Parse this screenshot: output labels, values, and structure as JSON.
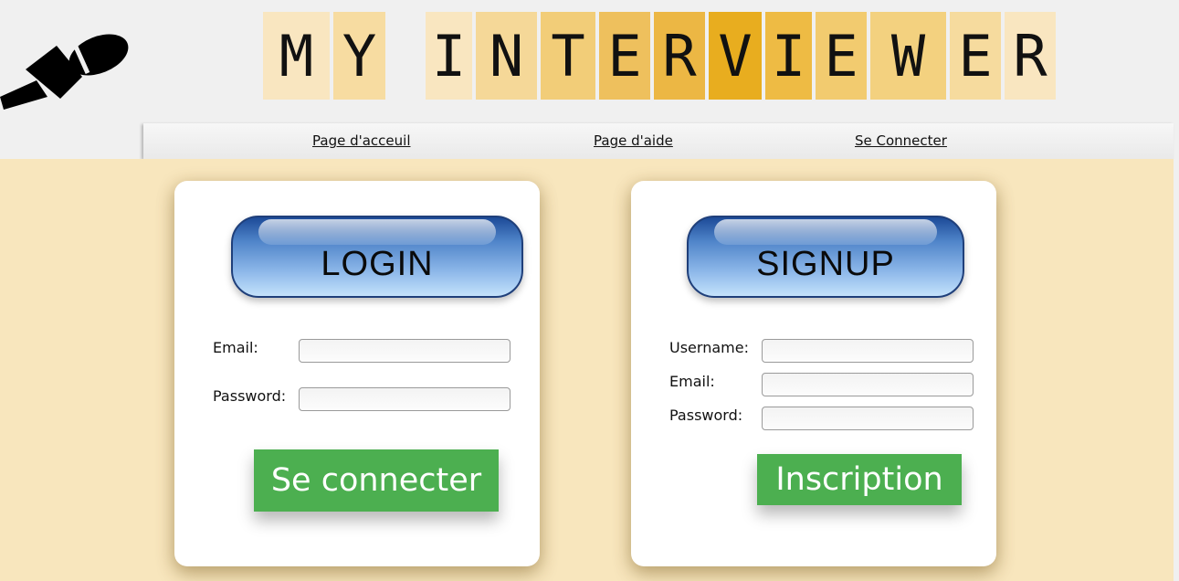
{
  "header": {
    "title_letters": [
      {
        "ch": "M",
        "color": "#f9e6c0"
      },
      {
        "ch": "Y",
        "color": "#f7dca1"
      },
      {
        "ch": "I",
        "color": "#f9e6c0"
      },
      {
        "ch": "N",
        "color": "#f5d898"
      },
      {
        "ch": "T",
        "color": "#f2cd78"
      },
      {
        "ch": "E",
        "color": "#eec05d"
      },
      {
        "ch": "R",
        "color": "#ecb744"
      },
      {
        "ch": "V",
        "color": "#e8ad1f"
      },
      {
        "ch": "I",
        "color": "#eebb44"
      },
      {
        "ch": "E",
        "color": "#f2cb6f"
      },
      {
        "ch": "W",
        "color": "#f3d17f"
      },
      {
        "ch": "E",
        "color": "#f6db9e"
      },
      {
        "ch": "R",
        "color": "#f9e6c0"
      }
    ],
    "logo_icon": "microphone-icon"
  },
  "nav": {
    "home": "Page d'acceuil",
    "help": "Page d'aide",
    "login": "Se Connecter"
  },
  "login": {
    "banner": "LOGIN",
    "email_label": "Email:",
    "email_value": "",
    "password_label": "Password:",
    "password_value": "",
    "submit": "Se connecter"
  },
  "signup": {
    "banner": "SIGNUP",
    "username_label": "Username:",
    "username_value": "",
    "email_label": "Email:",
    "email_value": "",
    "password_label": "Password:",
    "password_value": "",
    "submit": "Inscription"
  },
  "colors": {
    "page_background": "#f8e6bd",
    "button_green": "#4caf50"
  }
}
